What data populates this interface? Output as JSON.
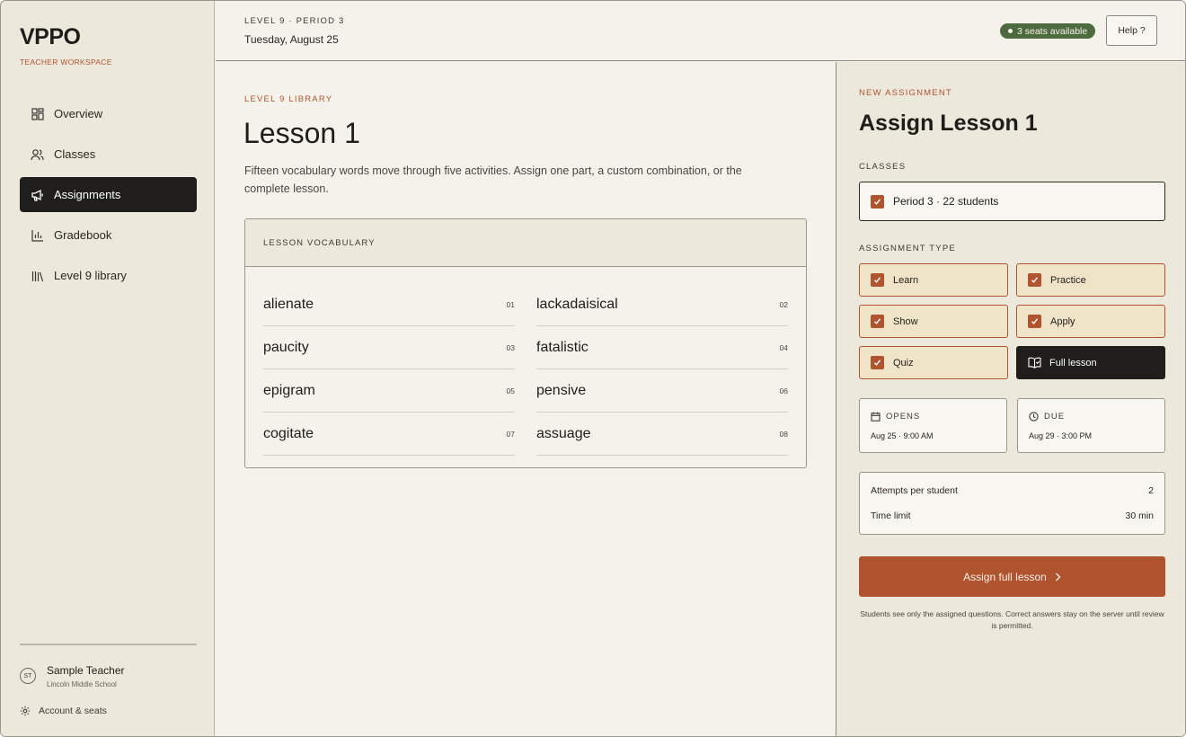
{
  "sidebar": {
    "logo": "VPPO",
    "subtitle": "TEACHER WORKSPACE",
    "items": [
      {
        "label": "Overview",
        "icon": "grid-icon"
      },
      {
        "label": "Classes",
        "icon": "users-icon"
      },
      {
        "label": "Assignments",
        "icon": "megaphone-icon",
        "active": true
      },
      {
        "label": "Gradebook",
        "icon": "bar-chart-icon"
      },
      {
        "label": "Level 9 library",
        "icon": "library-icon"
      }
    ],
    "user": {
      "initials": "ST",
      "name": "Sample Teacher",
      "school": "Lincoln Middle School"
    },
    "account_label": "Account & seats"
  },
  "header": {
    "level": "LEVEL 9 · PERIOD 3",
    "date": "Tuesday, August 25",
    "seats": "3 seats available",
    "help": "Help ?"
  },
  "main": {
    "eyebrow": "LEVEL 9 LIBRARY",
    "title": "Lesson 1",
    "description": "Fifteen vocabulary words move through five activities. Assign one part, a custom combination, or the complete lesson.",
    "vocab_header": "LESSON VOCABULARY",
    "words": [
      {
        "word": "alienate",
        "num": "01"
      },
      {
        "word": "lackadaisical",
        "num": "02"
      },
      {
        "word": "paucity",
        "num": "03"
      },
      {
        "word": "fatalistic",
        "num": "04"
      },
      {
        "word": "epigram",
        "num": "05"
      },
      {
        "word": "pensive",
        "num": "06"
      },
      {
        "word": "cogitate",
        "num": "07"
      },
      {
        "word": "assuage",
        "num": "08"
      }
    ]
  },
  "panel": {
    "eyebrow": "NEW ASSIGNMENT",
    "title": "Assign Lesson 1",
    "classes_label": "CLASSES",
    "class_option": "Period 3 · 22 students",
    "type_label": "ASSIGNMENT TYPE",
    "types": [
      {
        "label": "Learn",
        "checked": true
      },
      {
        "label": "Practice",
        "checked": true
      },
      {
        "label": "Show",
        "checked": true
      },
      {
        "label": "Apply",
        "checked": true
      },
      {
        "label": "Quiz",
        "checked": true
      },
      {
        "label": "Full lesson",
        "selected": true
      }
    ],
    "opens": {
      "label": "OPENS",
      "value": "Aug 25 · 9:00 AM"
    },
    "due": {
      "label": "DUE",
      "value": "Aug 29 · 3:00 PM"
    },
    "attempts": {
      "label": "Attempts per student",
      "value": "2"
    },
    "time_limit": {
      "label": "Time limit",
      "value": "30 min"
    },
    "assign_button": "Assign full lesson",
    "note": "Students see only the assigned questions. Correct answers stay on the server until review is permitted."
  },
  "colors": {
    "accent": "#b0532f",
    "success": "#4e6b3f",
    "dark": "#1f1e1c"
  }
}
